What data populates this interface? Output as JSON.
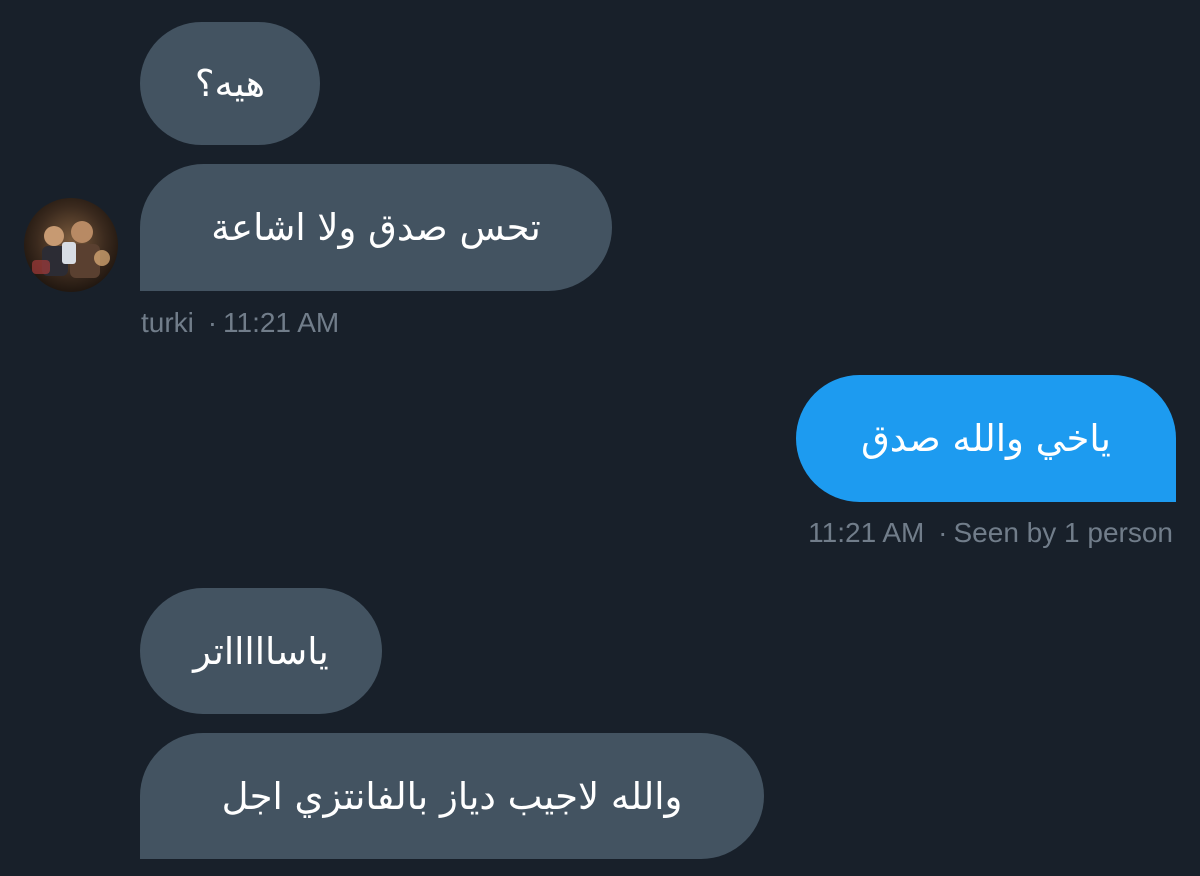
{
  "messages": [
    {
      "id": "m1",
      "direction": "incoming",
      "text": "هيه؟"
    },
    {
      "id": "m2",
      "direction": "incoming",
      "text": "تحس صدق ولا اشاعة"
    },
    {
      "id": "m3",
      "direction": "outgoing",
      "text": "ياخي والله صدق"
    },
    {
      "id": "m4",
      "direction": "incoming",
      "text": "ياساااااتر"
    },
    {
      "id": "m5",
      "direction": "incoming",
      "text": "والله لاجيب دياز بالفانتزي اجل"
    }
  ],
  "incoming_meta": {
    "sender": "turki",
    "separator": "·",
    "time": "11:21 AM"
  },
  "outgoing_meta": {
    "time": "11:21 AM",
    "separator": "·",
    "seen": "Seen by 1 person"
  },
  "avatar": {
    "icon": "user-avatar-photo"
  },
  "colors": {
    "background": "#18202a",
    "incoming_bubble": "#435361",
    "outgoing_bubble": "#1d9bf0",
    "meta_text": "#717d8a",
    "message_text": "#ffffff"
  }
}
